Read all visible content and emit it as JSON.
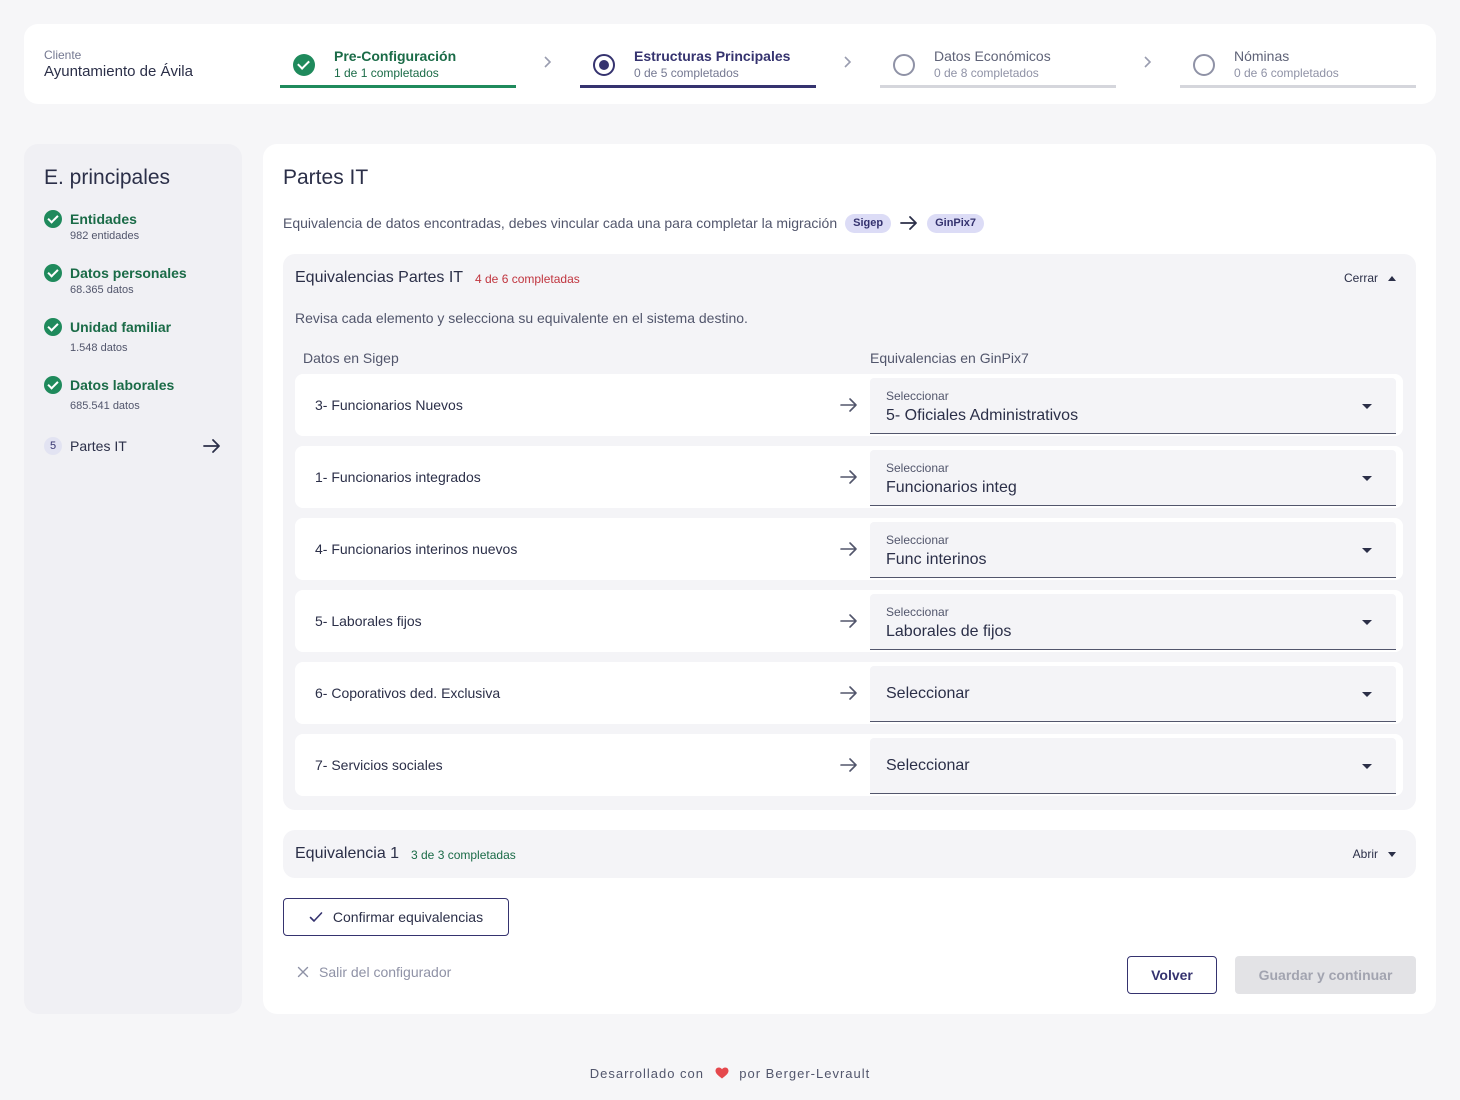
{
  "header": {
    "client_label": "Cliente",
    "client_name": "Ayuntamiento de Ávila",
    "steps": [
      {
        "title": "Pre-Configuración",
        "subtitle": "1 de 1 completados",
        "status": "done"
      },
      {
        "title": "Estructuras Principales",
        "subtitle": "0 de 5 completados",
        "status": "active"
      },
      {
        "title": "Datos Económicos",
        "subtitle": "0 de 8 completados",
        "status": "todo"
      },
      {
        "title": "Nóminas",
        "subtitle": "0 de 6 completados",
        "status": "todo"
      }
    ]
  },
  "sidebar": {
    "title": "E. principales",
    "items": [
      {
        "label": "Entidades",
        "count": "982 entidades",
        "status": "done"
      },
      {
        "label": "Datos personales",
        "count": "68.365 datos",
        "status": "done"
      },
      {
        "label": "Unidad familiar",
        "count": "1.548 datos",
        "status": "done"
      },
      {
        "label": "Datos laborales",
        "count": "685.541 datos",
        "status": "done"
      },
      {
        "label": "Partes IT",
        "number": "5",
        "status": "current",
        "icon": "arrow-right-icon"
      }
    ]
  },
  "main": {
    "title": "Partes IT",
    "description": "Equivalencia de datos encontradas, debes vincular cada una para completar la migración",
    "source_system": "Sigep",
    "target_system": "GinPix7",
    "panels": [
      {
        "title": "Equivalencias Partes IT",
        "status": "4 de 6 completadas",
        "toggle": "Cerrar",
        "hint": "Revisa cada elemento y selecciona su equivalente en el sistema destino.",
        "col_left": "Datos en Sigep",
        "col_right": "Equivalencias en GinPix7",
        "rows": [
          {
            "source": "3- Funcionarios Nuevos",
            "select_label": "Seleccionar",
            "value": "5- Oficiales Administrativos"
          },
          {
            "source": "1- Funcionarios integrados",
            "select_label": "Seleccionar",
            "value": "Funcionarios integ"
          },
          {
            "source": "4- Funcionarios interinos nuevos",
            "select_label": "Seleccionar",
            "value": "Func interinos"
          },
          {
            "source": "5- Laborales fijos",
            "select_label": "Seleccionar",
            "value": "Laborales de fijos"
          },
          {
            "source": "6- Coporativos ded. Exclusiva",
            "select_label": "Seleccionar",
            "value": ""
          },
          {
            "source": "7- Servicios sociales",
            "select_label": "Seleccionar",
            "value": ""
          }
        ]
      },
      {
        "title": "Equivalencia 1",
        "status": "3 de 3 completadas",
        "toggle": "Abrir"
      }
    ],
    "confirm_button": "Confirmar equivalencias",
    "exit_link": "Salir del configurador",
    "back_button": "Volver",
    "save_button": "Guardar y continuar"
  },
  "footer": {
    "prefix": "Desarrollado con",
    "suffix": "por Berger-Levrault"
  },
  "colors": {
    "accent": "#35336f",
    "success": "#1f8a5c",
    "danger": "#c0353f",
    "heart": "#e5484d"
  }
}
